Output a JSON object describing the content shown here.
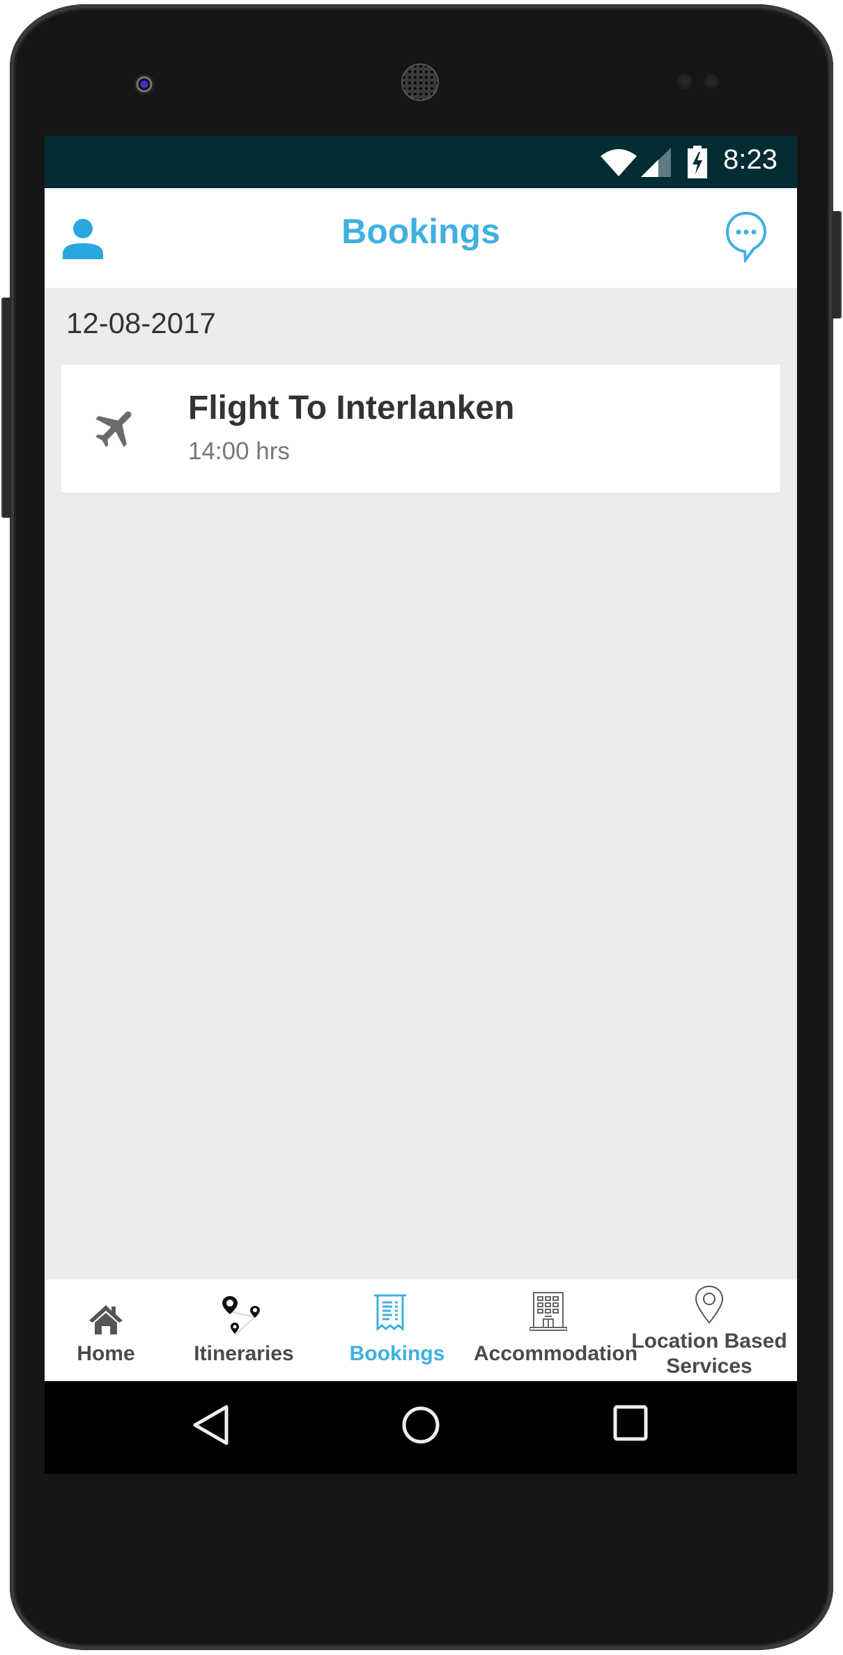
{
  "status_bar": {
    "time": "8:23",
    "icons": [
      "wifi-icon",
      "signal-icon",
      "battery-charging-icon"
    ],
    "background": "#042c33"
  },
  "app_bar": {
    "title": "Bookings",
    "left_icon": "user-icon",
    "right_icon": "chat-icon",
    "accent": "#3fb0e0"
  },
  "bookings": {
    "groups": [
      {
        "date": "12-08-2017",
        "items": [
          {
            "icon": "plane-icon",
            "title": "Flight To Interlanken",
            "time": "14:00 hrs"
          }
        ]
      }
    ]
  },
  "bottom_nav": {
    "items": [
      {
        "label": "Home",
        "icon": "home-icon",
        "active": false
      },
      {
        "label": "Itineraries",
        "icon": "itinerary-pins-icon",
        "active": false
      },
      {
        "label": "Bookings",
        "icon": "receipt-icon",
        "active": true
      },
      {
        "label": "Accommodation",
        "icon": "building-icon",
        "active": false
      },
      {
        "label_line1": "Location Based",
        "label_line2": "Services",
        "icon": "location-pin-icon",
        "active": false
      }
    ]
  },
  "system_nav": {
    "buttons": [
      "back-icon",
      "home-circle-icon",
      "recents-icon"
    ]
  }
}
